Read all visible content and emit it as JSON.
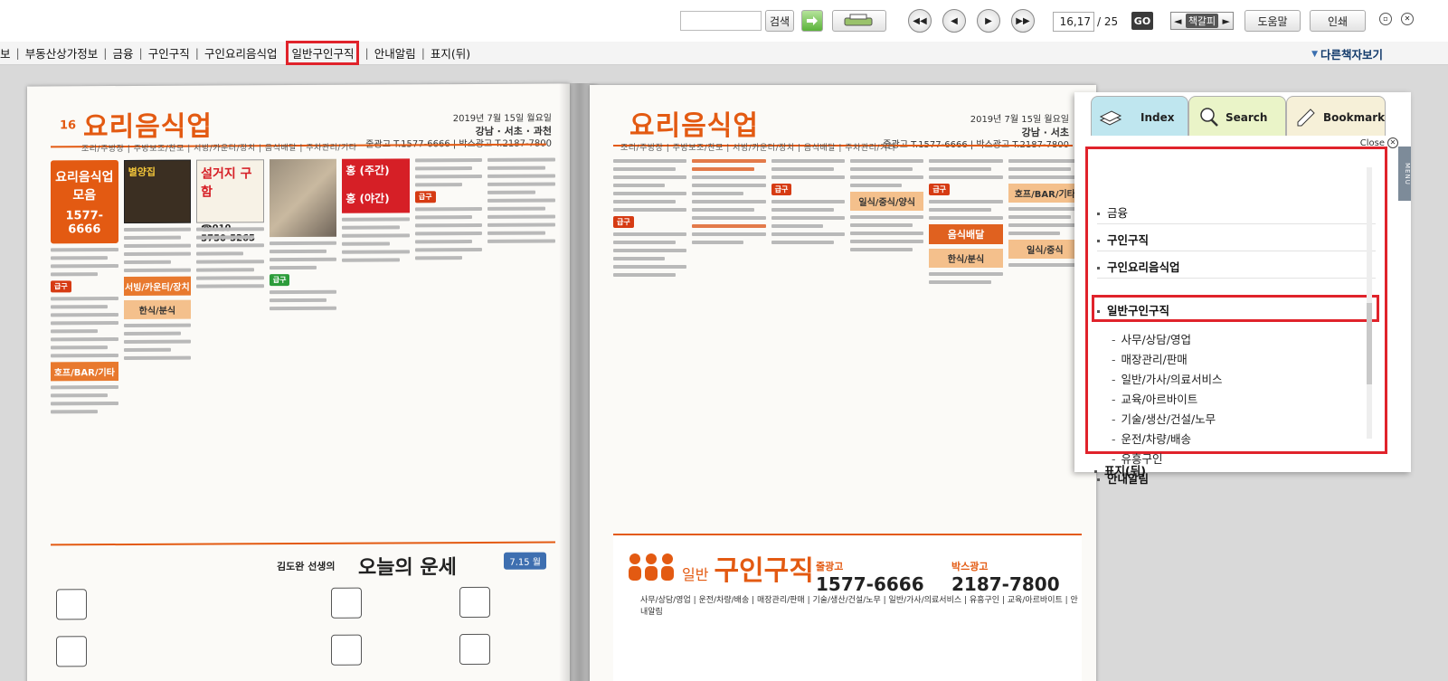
{
  "toolbar": {
    "search_button": "검색",
    "page_current": "16,17",
    "page_total": "/ 25",
    "go_button": "GO",
    "zoom_label": "책갈피",
    "zoom_minus": "◄",
    "zoom_plus": "►",
    "help_button": "도움말",
    "print_button": "인쇄"
  },
  "nav": {
    "items": [
      "보",
      "부동산상가정보",
      "금융",
      "구인구직",
      "구인요리음식업",
      "일반구인구직",
      "안내알림",
      "표지(뒤)"
    ],
    "active": "일반구인구직",
    "other_books": "다른책자보기"
  },
  "left_page": {
    "page_number": "16",
    "title": "요리음식업",
    "date_line": "2019년 7월 15일 월요일",
    "region": "강남 · 서초 · 과천",
    "phone_line": "줄광고 T.1577-6666 | 박스광고 T.2187-7800",
    "category_strip": "조리/주방장 | 주방보조/찬모 | 서빙/카운터/장치 | 음식배달 | 주차관리/기타",
    "promo_title": "요리음식업 모음",
    "promo_phone": "1577-6666",
    "section_labels": [
      "서빙/카운터/장치",
      "한식/분식",
      "호프/BAR/기타"
    ],
    "ad_texts": [
      "별양집",
      "설거지 구함",
      "☎010-5750-5265",
      "홍 (주간)",
      "홍 (야간)"
    ],
    "fortune_title": "오늘의 운세",
    "fortune_author": "김도완 선생의",
    "fortune_date": "7.15 월"
  },
  "right_page": {
    "title": "요리음식업",
    "date_line": "2019년 7월 15일 월요일",
    "region": "강남 · 서초",
    "phone_line": "줄광고 T.1577-6666 | 박스광고 T.2187-7800",
    "category_strip": "조리/주방장 | 주방보조/찬모 | 서빙/카운터/장치 | 음식배달 | 주차관리/기타",
    "section_labels": [
      "호프/BAR/기타",
      "일식/중식/양식",
      "음식배달",
      "한식/분식",
      "일식/중식"
    ],
    "jobs_prefix": "일반",
    "jobs_title": "구인구직",
    "jobs_categories": "사무/상담/영업 | 운전/차량/배송 | 매장관리/판매 | 기술/생산/건설/노무 | 일반/가사/의료서비스 | 유흥구인 | 교육/아르바이트 | 안내알림",
    "line_ad_label": "줄광고",
    "line_ad_phone": "1577-6666",
    "box_ad_label": "박스광고",
    "box_ad_phone": "2187-7800"
  },
  "index_panel": {
    "tab_index": "Index",
    "tab_search": "Search",
    "tab_bookmark": "Bookmark",
    "close": "Close",
    "menu": "MENU",
    "items": [
      "금융",
      "구인구직",
      "구인요리음식업",
      "일반구인구직",
      "안내알림",
      "표지(뒤)"
    ],
    "sub_items": [
      "사무/상담/영업",
      "매장관리/판매",
      "일반/가사/의료서비스",
      "교육/아르바이트",
      "기술/생산/건설/노무",
      "운전/차량/배송",
      "유흥구인"
    ]
  },
  "colors": {
    "accent": "#e35a12",
    "highlight": "#e0232b",
    "index_tab": "#bfe6ef",
    "search_tab": "#eaf4c8",
    "bookmark_tab": "#f6f0d8"
  }
}
